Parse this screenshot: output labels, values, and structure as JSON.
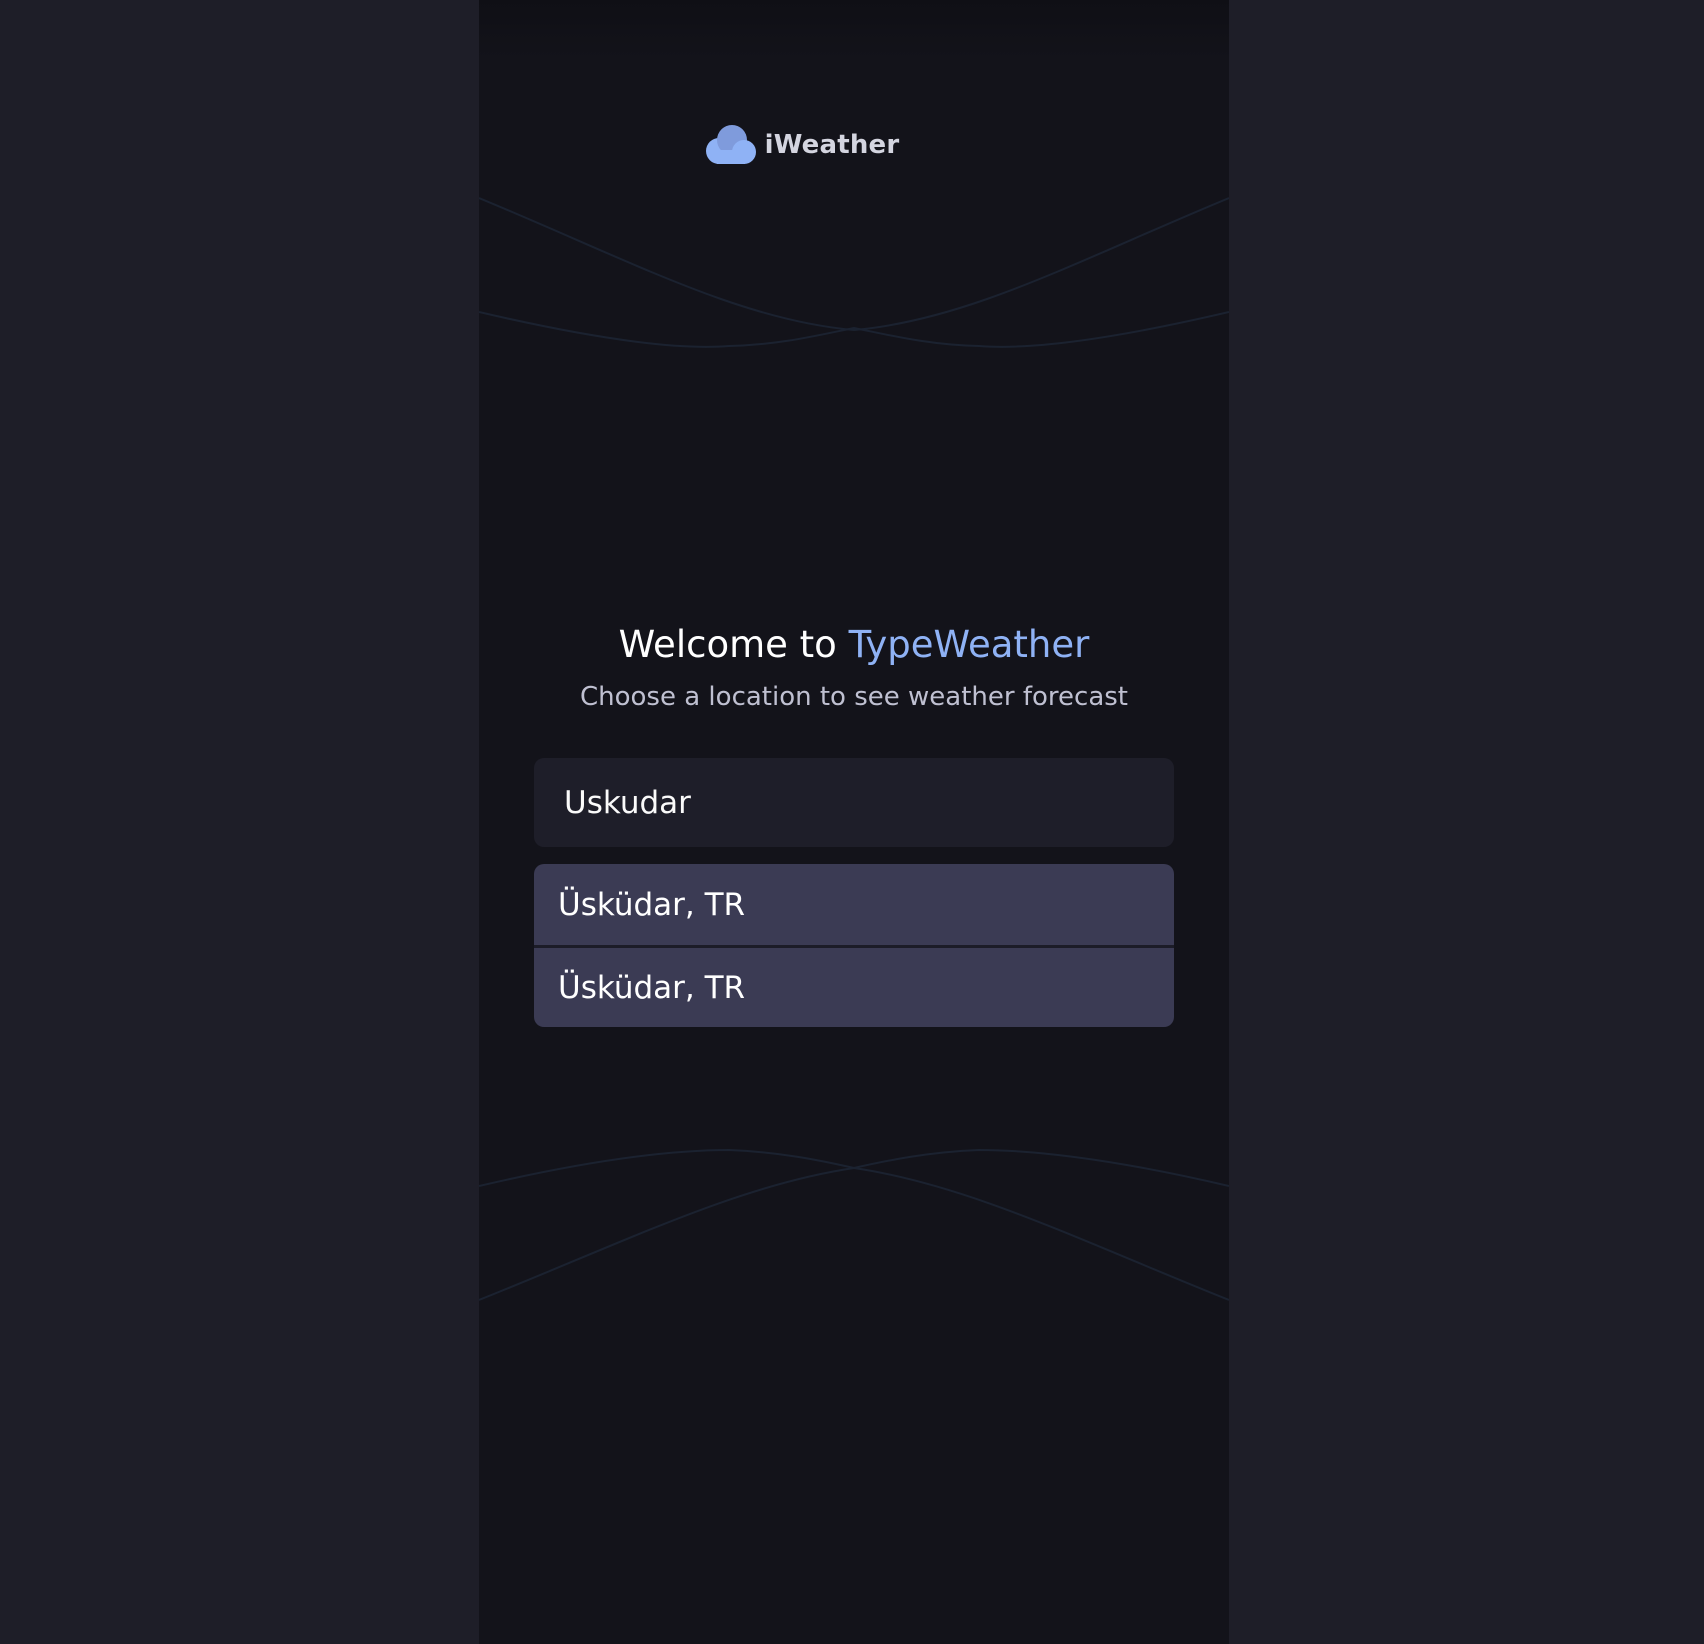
{
  "brand": {
    "name": "iWeather",
    "icon": "cloud-icon"
  },
  "welcome": {
    "prefix": "Welcome to ",
    "app_name": "TypeWeather",
    "subtitle": "Choose a location to see weather forecast"
  },
  "search": {
    "value": "Uskudar"
  },
  "suggestions": [
    {
      "label": "Üsküdar, TR"
    },
    {
      "label": "Üsküdar, TR"
    }
  ],
  "colors": {
    "accent": "#8fb2f5",
    "panel_background": "#13131a",
    "page_background": "#1e1e28",
    "input_background": "#1e1e29",
    "suggestion_background": "#3b3b54"
  }
}
